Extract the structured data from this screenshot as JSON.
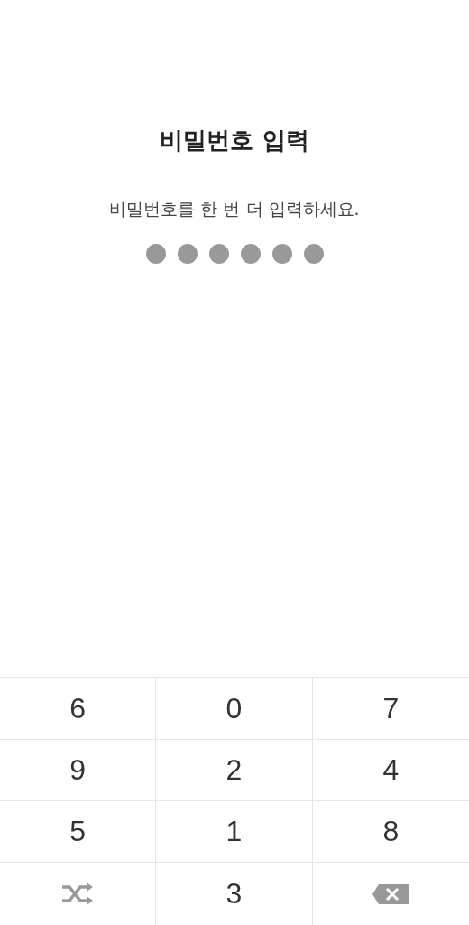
{
  "title": "비밀번호 입력",
  "message": "비밀번호를 한 번 더 입력하세요.",
  "pin_dots": [
    {
      "filled": true
    },
    {
      "filled": true
    },
    {
      "filled": true
    },
    {
      "filled": true
    },
    {
      "filled": true
    },
    {
      "filled": true
    }
  ],
  "keypad": [
    {
      "kind": "digit",
      "label": "6"
    },
    {
      "kind": "digit",
      "label": "0"
    },
    {
      "kind": "digit",
      "label": "7"
    },
    {
      "kind": "digit",
      "label": "9"
    },
    {
      "kind": "digit",
      "label": "2"
    },
    {
      "kind": "digit",
      "label": "4"
    },
    {
      "kind": "digit",
      "label": "5"
    },
    {
      "kind": "digit",
      "label": "1"
    },
    {
      "kind": "digit",
      "label": "8"
    },
    {
      "kind": "shuffle"
    },
    {
      "kind": "digit",
      "label": "3"
    },
    {
      "kind": "backspace"
    }
  ]
}
